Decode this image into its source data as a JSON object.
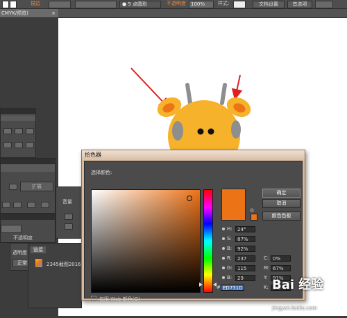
{
  "toolbar": {
    "stroke_label": "描边",
    "brush_value": "● 5 点圆形",
    "opacity_label": "不透明度",
    "opacity_value": "100%",
    "style_label": "样式:",
    "doc_setup_label": "文档设置",
    "preferences_label": "首选项"
  },
  "document_tab": {
    "title": "CMYK/预览)",
    "close": "×"
  },
  "left_panels": {
    "expand_label": "扩展",
    "opacity_label": "不透明度",
    "transparency_label": "透明度",
    "normal_label": "正常",
    "links_label": "链接",
    "link_item": "2345截图20160",
    "appearance_label": "音量"
  },
  "color_picker": {
    "title": "拾色器",
    "select_color_label": "选择颜色:",
    "ok_label": "确定",
    "cancel_label": "取消",
    "swatches_label": "颜色色板",
    "fields": {
      "H": {
        "label": "H:",
        "value": "24°"
      },
      "S": {
        "label": "S:",
        "value": "87%"
      },
      "B": {
        "label": "B:",
        "value": "92%"
      },
      "R": {
        "label": "R:",
        "value": "237"
      },
      "G": {
        "label": "G:",
        "value": "115"
      },
      "Bl": {
        "label": "B:",
        "value": "29"
      },
      "C": {
        "label": "C:",
        "value": "0%"
      },
      "M": {
        "label": "M:",
        "value": "67%"
      },
      "Y": {
        "label": "Y:",
        "value": "91%"
      },
      "K": {
        "label": "K:",
        "value": "0%"
      }
    },
    "hex": {
      "label": "#",
      "value": "ED731D"
    },
    "web_only_label": "仅限 Web 颜色(O)",
    "selected_color": "#ed7317"
  },
  "watermark": {
    "logo": "Bai 经验",
    "url": "jingyan.baidu.com"
  },
  "colors": {
    "giraffe_body": "#f6b22a",
    "giraffe_ear": "#ed7317",
    "arrow": "#e02020"
  }
}
